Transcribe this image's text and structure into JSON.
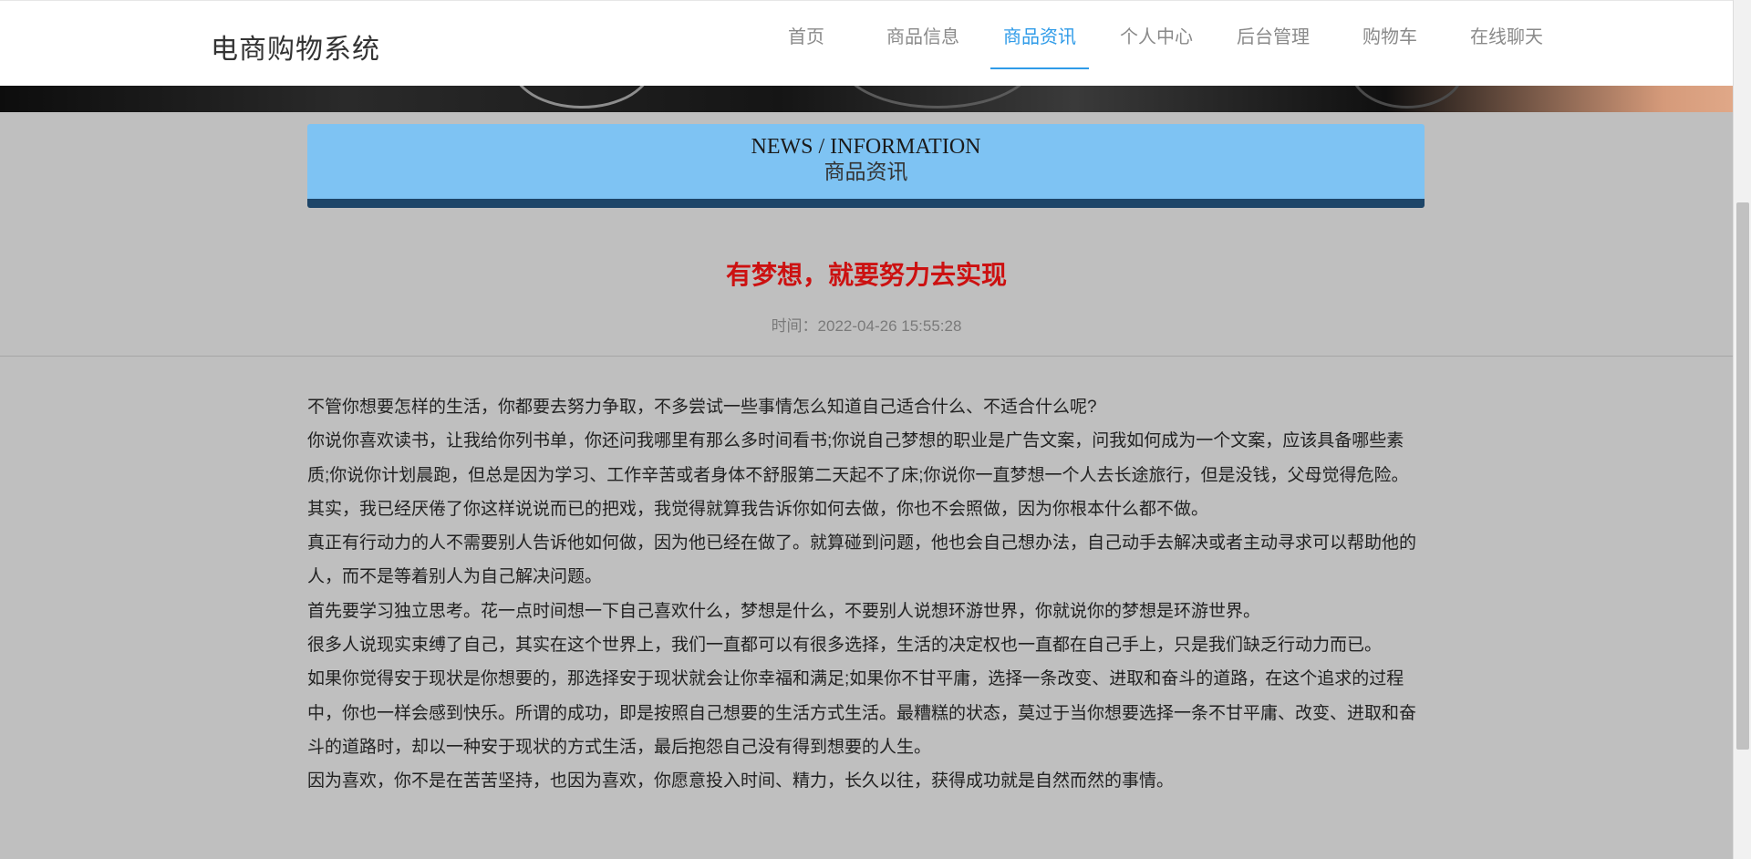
{
  "header": {
    "brand": "电商购物系统",
    "nav": [
      {
        "label": "首页",
        "active": false
      },
      {
        "label": "商品信息",
        "active": false
      },
      {
        "label": "商品资讯",
        "active": true
      },
      {
        "label": "个人中心",
        "active": false
      },
      {
        "label": "后台管理",
        "active": false
      },
      {
        "label": "购物车",
        "active": false
      },
      {
        "label": "在线聊天",
        "active": false
      }
    ],
    "accent_color": "#2f9be8"
  },
  "section": {
    "title_en": "NEWS / INFORMATION",
    "title_cn": "商品资讯"
  },
  "article": {
    "title": "有梦想，就要努力去实现",
    "time": "时间：2022-04-26 15:55:28",
    "title_color": "#cc1111",
    "paragraphs": [
      "不管你想要怎样的生活，你都要去努力争取，不多尝试一些事情怎么知道自己适合什么、不适合什么呢?",
      "你说你喜欢读书，让我给你列书单，你还问我哪里有那么多时间看书;你说自己梦想的职业是广告文案，问我如何成为一个文案，应该具备哪些素质;你说你计划晨跑，但总是因为学习、工作辛苦或者身体不舒服第二天起不了床;你说你一直梦想一个人去长途旅行，但是没钱，父母觉得危险。其实，我已经厌倦了你这样说说而已的把戏，我觉得就算我告诉你如何去做，你也不会照做，因为你根本什么都不做。",
      "真正有行动力的人不需要别人告诉他如何做，因为他已经在做了。就算碰到问题，他也会自己想办法，自己动手去解决或者主动寻求可以帮助他的人，而不是等着别人为自己解决问题。",
      "首先要学习独立思考。花一点时间想一下自己喜欢什么，梦想是什么，不要别人说想环游世界，你就说你的梦想是环游世界。",
      "很多人说现实束缚了自己，其实在这个世界上，我们一直都可以有很多选择，生活的决定权也一直都在自己手上，只是我们缺乏行动力而已。",
      "如果你觉得安于现状是你想要的，那选择安于现状就会让你幸福和满足;如果你不甘平庸，选择一条改变、进取和奋斗的道路，在这个追求的过程中，你也一样会感到快乐。所谓的成功，即是按照自己想要的生活方式生活。最糟糕的状态，莫过于当你想要选择一条不甘平庸、改变、进取和奋斗的道路时，却以一种安于现状的方式生活，最后抱怨自己没有得到想要的人生。",
      "因为喜欢，你不是在苦苦坚持，也因为喜欢，你愿意投入时间、精力，长久以往，获得成功就是自然而然的事情。"
    ]
  }
}
